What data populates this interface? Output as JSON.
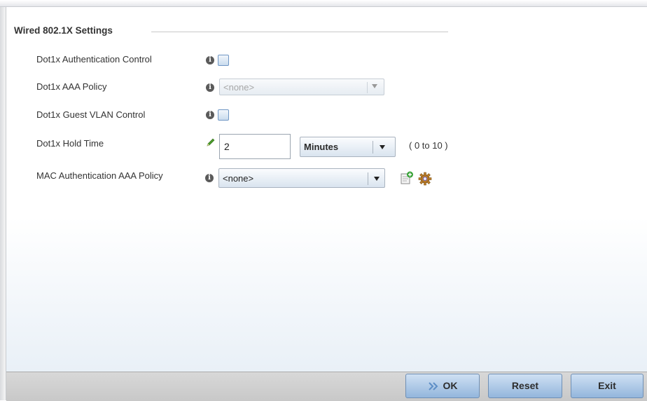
{
  "section": {
    "title": "Wired 802.1X Settings"
  },
  "fields": {
    "auth_control": {
      "label": "Dot1x Authentication Control",
      "checked": false
    },
    "aaa_policy": {
      "label": "Dot1x AAA Policy",
      "value": "<none>",
      "disabled": true
    },
    "guest_vlan": {
      "label": "Dot1x Guest VLAN Control",
      "checked": false
    },
    "hold_time": {
      "label": "Dot1x Hold Time",
      "value": "2",
      "unit": "Minutes",
      "range": "( 0 to 10 )"
    },
    "mac_auth": {
      "label": "MAC Authentication AAA Policy",
      "value": "<none>"
    }
  },
  "icons": {
    "info": "info-icon",
    "edit": "pencil-icon",
    "create": "add-policy-icon",
    "configure": "gear-icon"
  },
  "buttons": {
    "ok": "OK",
    "reset": "Reset",
    "exit": "Exit"
  },
  "colors": {
    "button_blue": "#93b6dc",
    "checkbox_border": "#6f96c4",
    "bar_gray": "#c8c8c8"
  }
}
